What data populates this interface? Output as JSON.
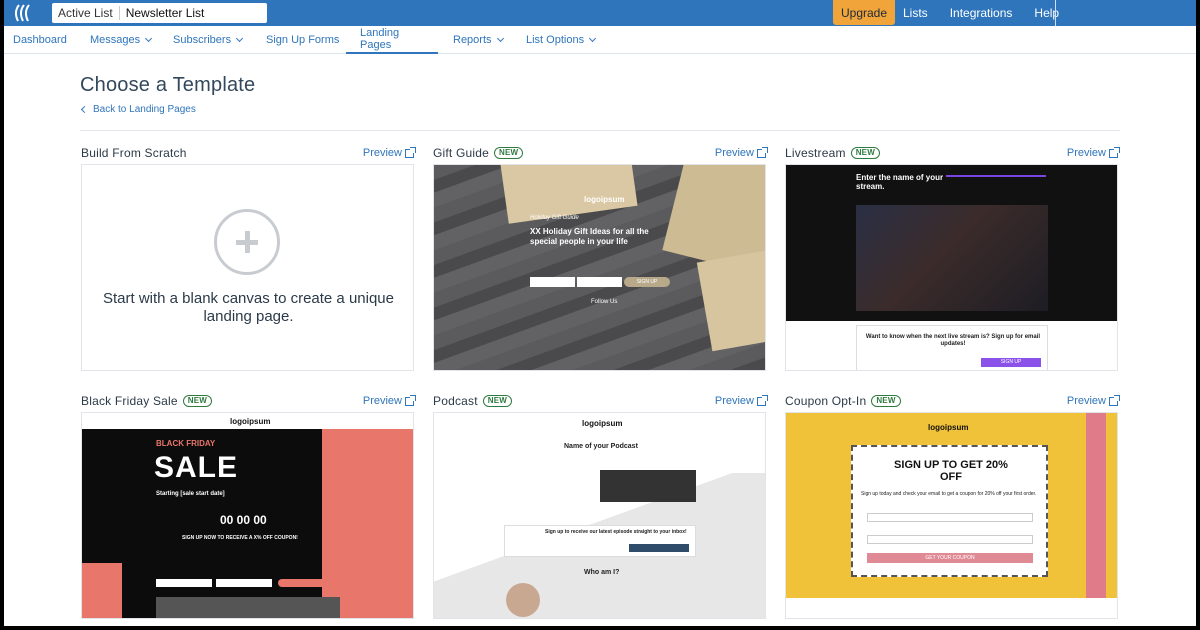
{
  "topbar": {
    "list_label": "Active List",
    "list_value": "Newsletter List",
    "upgrade": "Upgrade",
    "nav": [
      "Lists",
      "Integrations",
      "Help"
    ]
  },
  "subnav": {
    "dashboard": "Dashboard",
    "messages": "Messages",
    "subscribers": "Subscribers",
    "signup_forms": "Sign Up Forms",
    "landing_pages": "Landing Pages",
    "reports": "Reports",
    "list_options": "List Options"
  },
  "page": {
    "title": "Choose a Template",
    "back": "Back to Landing Pages"
  },
  "preview_label": "Preview",
  "new_badge": "NEW",
  "templates": [
    {
      "name": "Build From Scratch",
      "is_new": false,
      "body": "Start with a blank canvas to create a unique landing page."
    },
    {
      "name": "Gift Guide",
      "is_new": true,
      "logo": "logoipsum",
      "kicker": "Holiday Gift Guide",
      "headline": "XX Holiday Gift Ideas for all the special people in your life",
      "follow": "Follow Us",
      "cta": "SIGN UP"
    },
    {
      "name": "Livestream",
      "is_new": true,
      "headline": "Enter the name of your stream.",
      "form_title": "Want to know when the next live stream is? Sign up for email updates!",
      "cta": "SIGN UP"
    },
    {
      "name": "Black Friday Sale",
      "is_new": true,
      "logo": "logoipsum",
      "kicker": "BLACK FRIDAY",
      "sale": "SALE",
      "start": "Starting [sale start date]",
      "countdown": "00 00 00",
      "coupon_line": "SIGN UP NOW TO RECEIVE A X% OFF COUPON!"
    },
    {
      "name": "Podcast",
      "is_new": true,
      "logo": "logoipsum",
      "headline": "Name of your Podcast",
      "signup": "Sign up to receive our latest episode straight to your inbox!",
      "who": "Who am I?"
    },
    {
      "name": "Coupon Opt-In",
      "is_new": true,
      "logo": "logoipsum",
      "headline": "SIGN UP TO GET 20% OFF",
      "sub": "Sign up today and check your email to get a coupon for 20% off your first order.",
      "cta": "GET YOUR COUPON"
    }
  ],
  "colors": {
    "brand": "#2f75bb",
    "upgrade": "#f1a43a",
    "badge": "#2f7a3f"
  }
}
